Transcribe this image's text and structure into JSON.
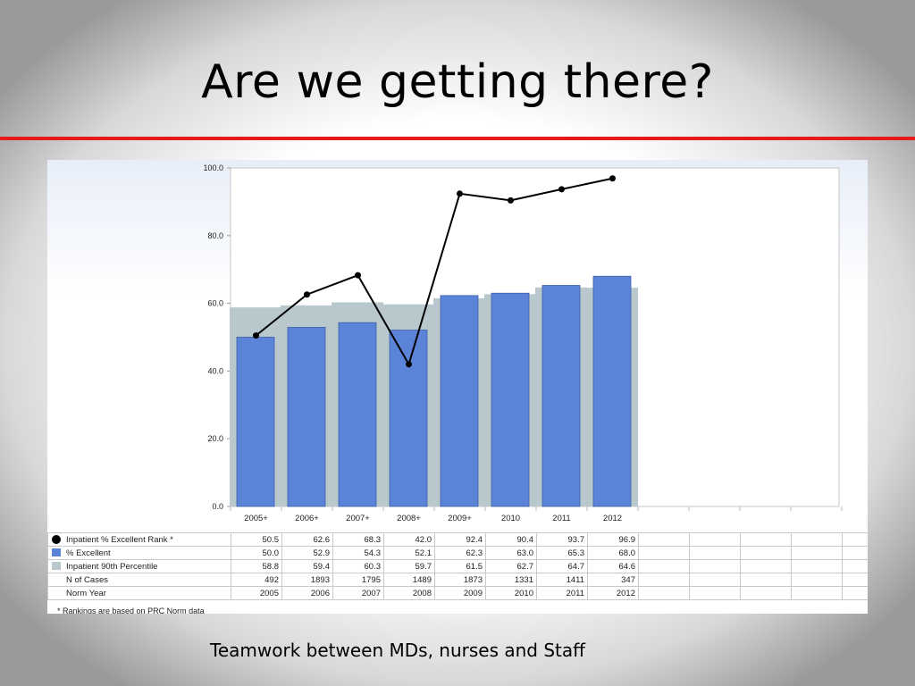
{
  "slide": {
    "title": "Are we getting there?",
    "caption": "Teamwork between MDs, nurses and  Staff",
    "footnote": "* Rankings are based on PRC Norm data"
  },
  "colors": {
    "title_rule": "#e31b1b",
    "excellent_bar": "#5b84d8",
    "percentile_bar": "#b8c8cc",
    "rank_line": "#000000"
  },
  "chart_data": {
    "type": "bar",
    "categories": [
      "2005+",
      "2006+",
      "2007+",
      "2008+",
      "2009+",
      "2010",
      "2011",
      "2012"
    ],
    "ylim": [
      0,
      100
    ],
    "yticks": [
      "0.0",
      "20.0",
      "40.0",
      "60.0",
      "80.0",
      "100.0"
    ],
    "series": [
      {
        "name": "Inpatient % Excellent Rank *",
        "type": "line",
        "values": [
          50.5,
          62.6,
          68.3,
          42.0,
          92.4,
          90.4,
          93.7,
          96.9
        ],
        "labels": [
          "50.5",
          "62.6",
          "68.3",
          "42.0",
          "92.4",
          "90.4",
          "93.7",
          "96.9"
        ]
      },
      {
        "name": "% Excellent",
        "type": "bar",
        "values": [
          50.0,
          52.9,
          54.3,
          52.1,
          62.3,
          63.0,
          65.3,
          68.0
        ],
        "labels": [
          "50.0",
          "52.9",
          "54.3",
          "52.1",
          "62.3",
          "63.0",
          "65.3",
          "68.0"
        ]
      },
      {
        "name": "Inpatient 90th Percentile",
        "type": "area",
        "values": [
          58.8,
          59.4,
          60.3,
          59.7,
          61.5,
          62.7,
          64.7,
          64.6
        ],
        "labels": [
          "58.8",
          "59.4",
          "60.3",
          "59.7",
          "61.5",
          "62.7",
          "64.7",
          "64.6"
        ]
      }
    ],
    "table_rows": [
      {
        "name": "N of Cases",
        "values": [
          "492",
          "1893",
          "1795",
          "1489",
          "1873",
          "1331",
          "1411",
          "347"
        ]
      },
      {
        "name": "Norm Year",
        "values": [
          "2005",
          "2006",
          "2007",
          "2008",
          "2009",
          "2010",
          "2011",
          "2012"
        ]
      }
    ],
    "empty_columns": 5,
    "grid": false,
    "legend": "table-left"
  }
}
